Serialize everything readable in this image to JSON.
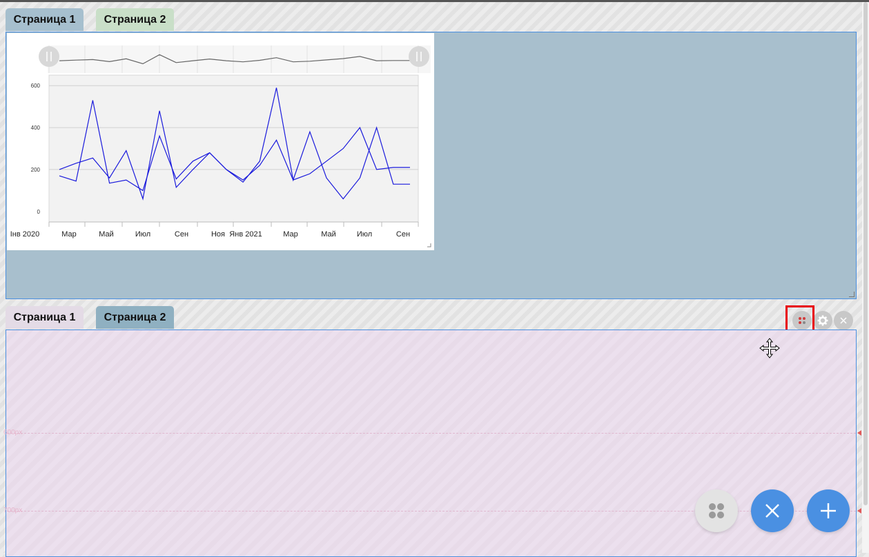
{
  "top_tabs": [
    {
      "label": "Страница 1",
      "active": true
    },
    {
      "label": "Страница 2",
      "active": false
    }
  ],
  "bottom_tabs": [
    {
      "label": "Страница 1",
      "active": false
    },
    {
      "label": "Страница 2",
      "active": true
    }
  ],
  "guides": [
    {
      "label": "600px"
    },
    {
      "label": "700px"
    }
  ],
  "widget_controls": {
    "layout_icon": "dots-grid-icon",
    "settings_icon": "gear-icon",
    "close_icon": "close-icon"
  },
  "fab": {
    "apps_icon": "apps-icon",
    "close_icon": "close-icon",
    "add_icon": "plus-icon",
    "accent_color": "#4a90e2"
  },
  "chart_data": {
    "type": "line",
    "x": [
      "2020-01",
      "2020-02",
      "2020-03",
      "2020-04",
      "2020-05",
      "2020-06",
      "2020-07",
      "2020-08",
      "2020-09",
      "2020-10",
      "2020-11",
      "2020-12",
      "2021-01",
      "2021-02",
      "2021-03",
      "2021-04",
      "2021-05",
      "2021-06",
      "2021-07",
      "2021-08",
      "2021-09",
      "2021-10"
    ],
    "x_tick_labels": [
      "Інв 2020",
      "Мар",
      "Май",
      "Июл",
      "Сен",
      "Ноя",
      "Янв 2021",
      "Мар",
      "Май",
      "Июл",
      "Сен"
    ],
    "y_ticks": [
      "0",
      "200",
      "400",
      "600"
    ],
    "ylim": [
      -50,
      650
    ],
    "series": [
      {
        "color": "#1a1adc",
        "values": [
          170,
          145,
          530,
          135,
          150,
          100,
          360,
          155,
          240,
          280,
          200,
          140,
          240,
          590,
          150,
          380,
          160,
          60,
          160,
          400,
          130,
          130
        ]
      },
      {
        "color": "#1a1adc",
        "values": [
          200,
          230,
          255,
          160,
          290,
          60,
          480,
          115,
          200,
          280,
          200,
          150,
          220,
          340,
          150,
          180,
          240,
          300,
          400,
          200,
          210,
          210
        ]
      }
    ],
    "overview_values": [
      91,
      92,
      94,
      88,
      87,
      86,
      85,
      84,
      83,
      82,
      81,
      80,
      80,
      80,
      80,
      80,
      80,
      80,
      80,
      80,
      80,
      80
    ]
  }
}
